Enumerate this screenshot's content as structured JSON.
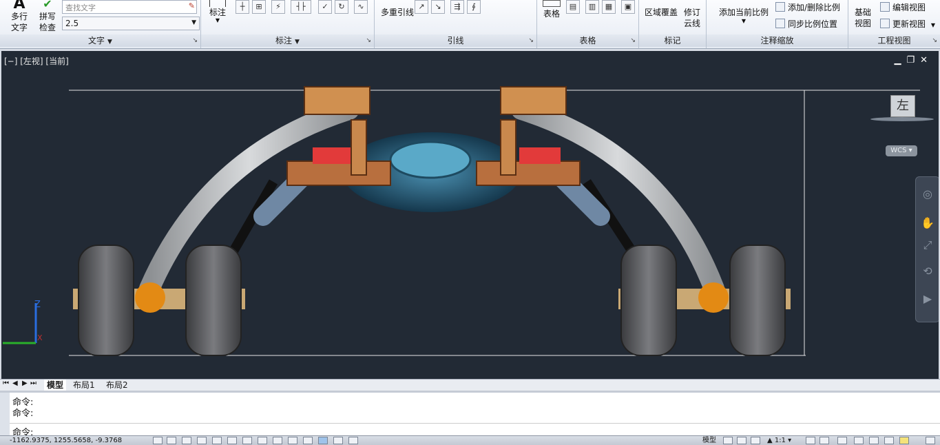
{
  "ribbon": {
    "text_panel": {
      "title": "文字",
      "mtext_label": "多行\n文字",
      "spell_label": "拼写\n检查",
      "search_placeholder": "查找文字",
      "text_height": "2.5"
    },
    "dim_panel": {
      "title": "标注",
      "dim_label": "标注"
    },
    "leader_panel": {
      "title": "引线",
      "mleader_label": "多重引线"
    },
    "table_panel": {
      "title": "表格",
      "table_label": "表格"
    },
    "markup_panel": {
      "title": "标记",
      "wipeout_label": "区域覆盖",
      "revcloud_label": "修订\n云线"
    },
    "annoscale_panel": {
      "title": "注释缩放",
      "add_scale_label": "添加当前比例",
      "add_delete_label": "添加/删除比例",
      "sync_label": "同步比例位置"
    },
    "drawview_panel": {
      "title": "工程视图",
      "base_label": "基础\n视图",
      "edit_label": "编辑视图",
      "update_label": "更新视图"
    }
  },
  "viewport": {
    "label": "[−] [左视] [当前]",
    "viewcube_face": "左",
    "wcs": "WCS",
    "axis_x": "X",
    "axis_y": "Y",
    "axis_z": "Z"
  },
  "layout_tabs": [
    "模型",
    "布局1",
    "布局2"
  ],
  "command": {
    "lines": [
      "命令:",
      "命令:"
    ],
    "prompt": "命令:"
  },
  "status": {
    "coords": "-1162.9375, 1255.5658, -9.3768",
    "model": "模型",
    "scale": "1:1"
  },
  "colors": {
    "viewport_bg": "#222a35",
    "wheel": "#5f6063",
    "arm": "#b7b9bb",
    "copper": "#b86f3e",
    "hub": "#2c5f7a",
    "ball": "#e38a14"
  }
}
